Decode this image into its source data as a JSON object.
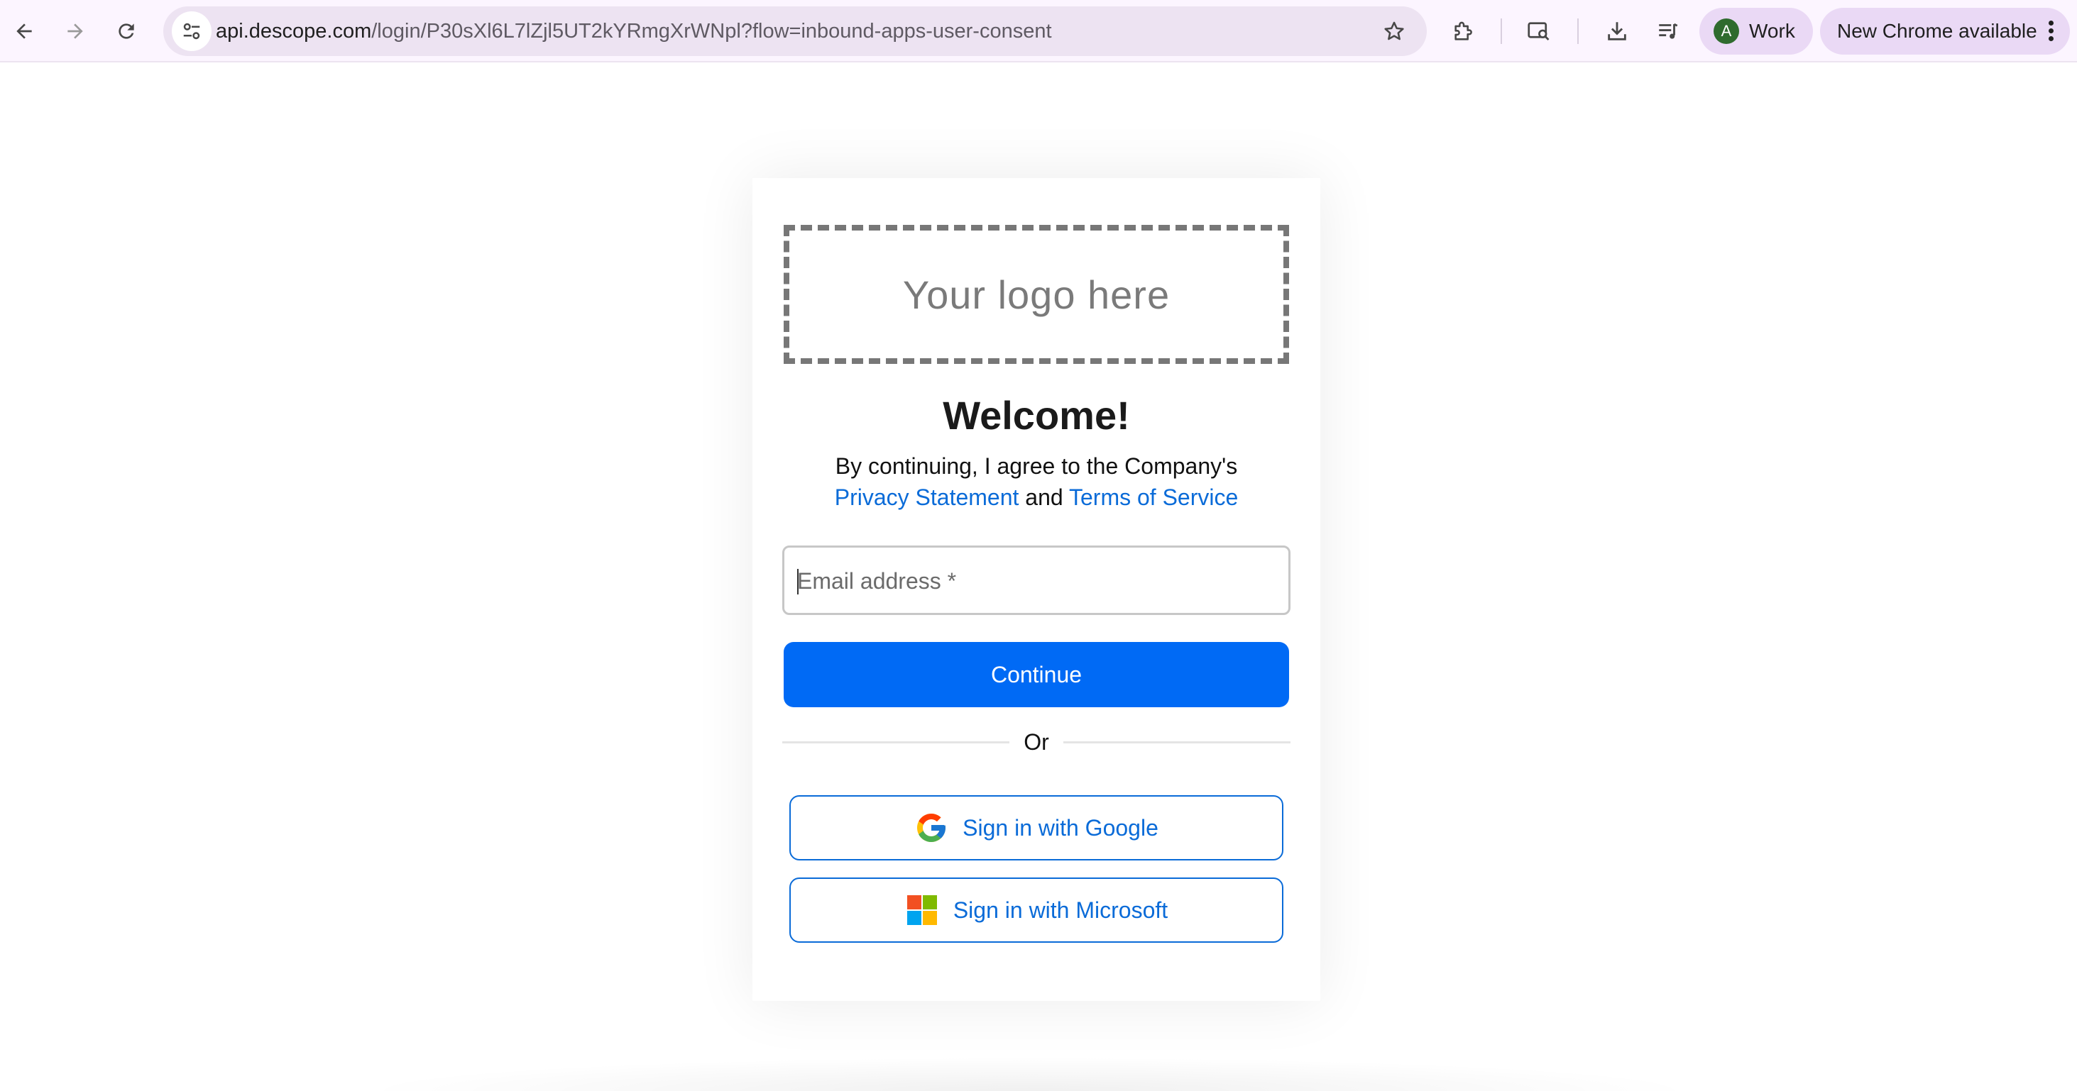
{
  "browser": {
    "url_host": "api.descope.com",
    "url_rest": "/login/P30sXl6L7lZjl5UT2kYRmgXrWNpl?flow=inbound-apps-user-consent",
    "profile_initial": "A",
    "profile_label": "Work",
    "update_label": "New Chrome available",
    "icons": [
      "back-arrow-icon",
      "forward-arrow-icon",
      "reload-icon",
      "site-info-tune-icon",
      "bookmark-star-icon",
      "extensions-puzzle-icon",
      "tab-search-icon",
      "download-icon",
      "media-control-icon",
      "more-vertical-icon"
    ]
  },
  "login": {
    "logo_placeholder": "Your logo here",
    "title": "Welcome!",
    "consent_prefix": "By continuing, I agree to the Company's",
    "privacy_link": "Privacy Statement",
    "and_text": "and",
    "terms_link": "Terms of Service",
    "email_placeholder": "Email address *",
    "continue_label": "Continue",
    "divider_text": "Or",
    "google_label": "Sign in with Google",
    "microsoft_label": "Sign in with Microsoft"
  },
  "colors": {
    "primary": "#006af5",
    "link": "#0a6bd8",
    "chrome_toolbar": "#fcf5ff",
    "chip": "#ead9f5",
    "avatar": "#2f6b2e"
  }
}
